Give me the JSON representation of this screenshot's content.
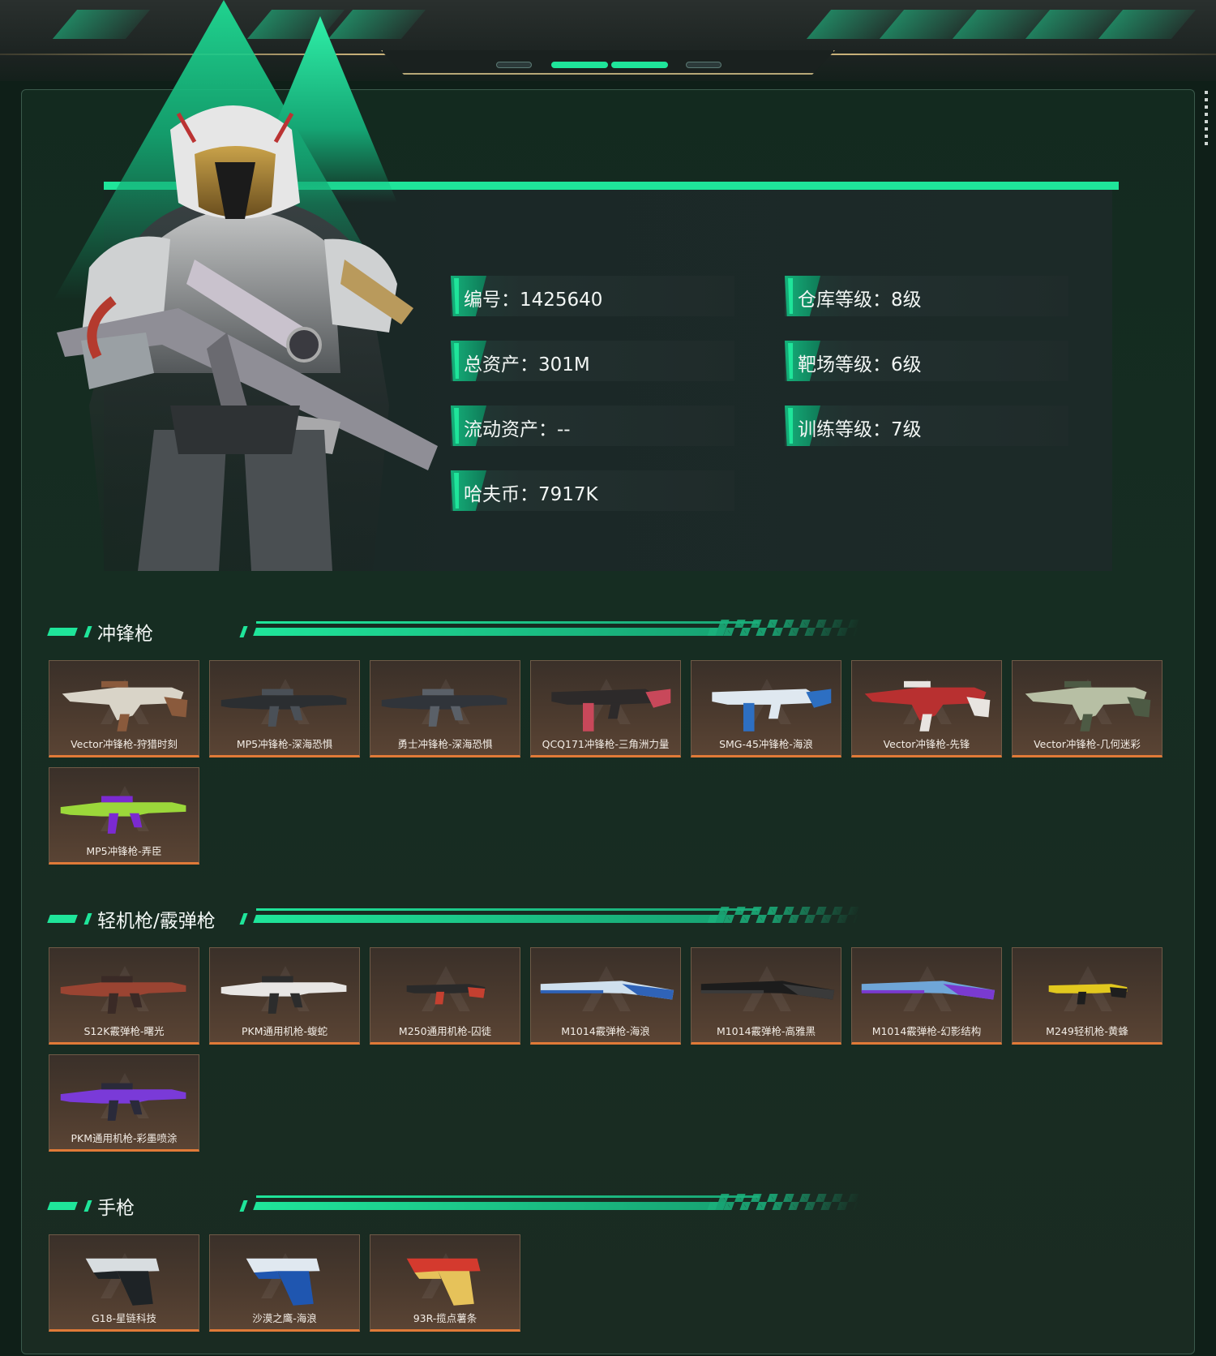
{
  "profile": {
    "stats_left": [
      "编号：1425640",
      "总资产：301M",
      "流动资产：--",
      "哈夫币：7917K"
    ],
    "stats_right": [
      "仓库等级：8级",
      "靶场等级：6级",
      "训练等级：7级"
    ]
  },
  "sections": [
    {
      "title": "冲锋枪",
      "items": [
        {
          "name": "Vector冲锋枪-狩猎时刻",
          "colors": [
            "#d9d4c8",
            "#8a5a3c"
          ],
          "shape": "vector"
        },
        {
          "name": "MP5冲锋枪-深海恐惧",
          "colors": [
            "#2b2e31",
            "#4a5057"
          ],
          "shape": "rifle"
        },
        {
          "name": "勇士冲锋枪-深海恐惧",
          "colors": [
            "#30343a",
            "#5a6068"
          ],
          "shape": "rifle"
        },
        {
          "name": "QCQ171冲锋枪-三角洲力量",
          "colors": [
            "#2d2a2a",
            "#c8485a"
          ],
          "shape": "smg"
        },
        {
          "name": "SMG-45冲锋枪-海浪",
          "colors": [
            "#dfe8f0",
            "#2d6fc2"
          ],
          "shape": "smg"
        },
        {
          "name": "Vector冲锋枪-先锋",
          "colors": [
            "#b83030",
            "#e8e4e0"
          ],
          "shape": "vector"
        },
        {
          "name": "Vector冲锋枪-几何迷彩",
          "colors": [
            "#b7bfa4",
            "#4d5a44"
          ],
          "shape": "vector"
        },
        {
          "name": "MP5冲锋枪-弄臣",
          "colors": [
            "#9bd83a",
            "#7b2ad1"
          ],
          "shape": "rifle"
        }
      ]
    },
    {
      "title": "轻机枪/霰弹枪",
      "items": [
        {
          "name": "S12K霰弹枪-曙光",
          "colors": [
            "#9a4432",
            "#3a2a26"
          ],
          "shape": "rifle"
        },
        {
          "name": "PKM通用机枪-蝮蛇",
          "colors": [
            "#e8e6e4",
            "#2c2c2c"
          ],
          "shape": "rifle"
        },
        {
          "name": "M250通用机枪-囚徒",
          "colors": [
            "#2a2a2a",
            "#c44030"
          ],
          "shape": "small"
        },
        {
          "name": "M1014霰弹枪-海浪",
          "colors": [
            "#cfe0ee",
            "#2f63b8"
          ],
          "shape": "shotgun"
        },
        {
          "name": "M1014霰弹枪-高雅黑",
          "colors": [
            "#1c1c1c",
            "#3a3a3a"
          ],
          "shape": "shotgun"
        },
        {
          "name": "M1014霰弹枪-幻影结构",
          "colors": [
            "#6fa6d8",
            "#7a3ad0"
          ],
          "shape": "shotgun"
        },
        {
          "name": "M249轻机枪-黄蜂",
          "colors": [
            "#e2c81e",
            "#1e1e1e"
          ],
          "shape": "small"
        },
        {
          "name": "PKM通用机枪-彩墨喷涂",
          "colors": [
            "#7a3ad8",
            "#2a2a3a"
          ],
          "shape": "rifle"
        }
      ]
    },
    {
      "title": "手枪",
      "items": [
        {
          "name": "G18-星链科技",
          "colors": [
            "#d8dde0",
            "#1e2326"
          ],
          "shape": "pistol"
        },
        {
          "name": "沙漠之鹰-海浪",
          "colors": [
            "#e0e8f0",
            "#1f56b0"
          ],
          "shape": "pistol"
        },
        {
          "name": "93R-揽点薯条",
          "colors": [
            "#d43a2e",
            "#e6c25a"
          ],
          "shape": "pistol"
        }
      ]
    }
  ]
}
